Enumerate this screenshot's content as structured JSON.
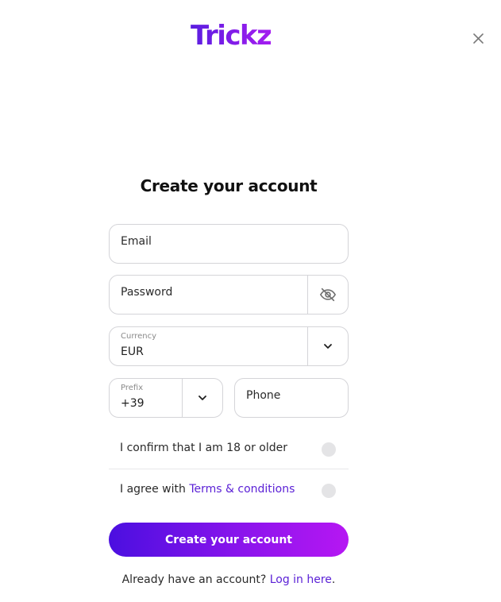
{
  "brand": {
    "logo_text": "Trickz",
    "accent": "#5b21d6",
    "gradient_start": "#4b0fe0",
    "gradient_end": "#b617f3"
  },
  "header": {
    "close_icon": "close-icon"
  },
  "form": {
    "title": "Create your account",
    "email": {
      "placeholder": "Email"
    },
    "password": {
      "placeholder": "Password",
      "toggle_icon": "eye-off-icon"
    },
    "currency": {
      "label": "Currency",
      "value": "EUR",
      "icon": "chevron-down-icon"
    },
    "prefix": {
      "label": "Prefix",
      "value": "+39",
      "icon": "chevron-down-icon"
    },
    "phone": {
      "placeholder": "Phone"
    },
    "age_confirm": {
      "text": "I confirm that I am 18 or older",
      "checked": false
    },
    "terms": {
      "prefix": "I agree with ",
      "link": "Terms & conditions",
      "checked": false
    },
    "submit_label": "Create your account"
  },
  "footer": {
    "text": "Already have an account? ",
    "link": "Log in here",
    "trailing": "."
  }
}
